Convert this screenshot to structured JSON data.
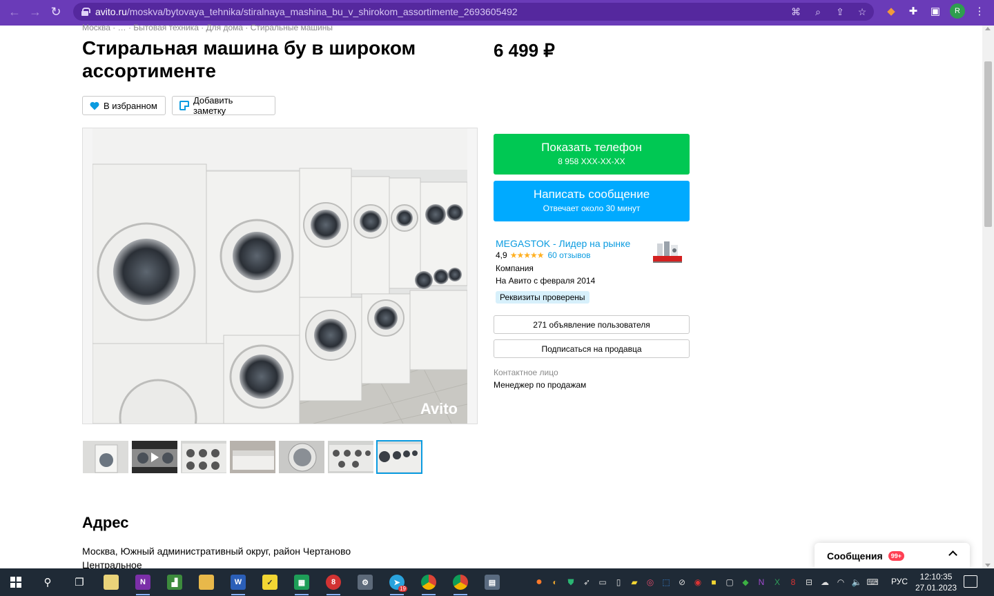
{
  "browser": {
    "url_host": "avito.ru",
    "url_path": "/moskva/bytovaya_tehnika/stiralnaya_mashina_bu_v_shirokom_assortimente_2693605492",
    "profile_initial": "R"
  },
  "listing": {
    "breadcrumbs": "Москва · … · Бытовая техника · Для дома · Стиральные машины",
    "title": "Стиральная машина бу в широком ассортименте",
    "price": "6 499 ₽",
    "favorite_label": "В избранном",
    "note_label": "Добавить заметку",
    "photo_watermark": "Avito",
    "thumbnails": [
      "thumb-1",
      "thumb-2-video",
      "thumb-3",
      "thumb-4",
      "thumb-5",
      "thumb-6",
      "thumb-7-active"
    ]
  },
  "contact": {
    "show_phone_label": "Показать телефон",
    "phone_masked": "8 958 XXX-XX-XX",
    "write_message_label": "Написать сообщение",
    "response_time": "Отвечает около 30 минут"
  },
  "seller": {
    "name": "MEGASTOK - Лидер на рынке",
    "rating": "4,9",
    "stars": "★★★★★",
    "reviews": "60 отзывов",
    "type": "Компания",
    "since": "На Авито с февраля 2014",
    "verified": "Реквизиты проверены",
    "listings_button": "271 объявление пользователя",
    "subscribe_button": "Подписаться на продавца",
    "contact_person_label": "Контактное лицо",
    "contact_person_value": "Менеджер по продажам"
  },
  "address": {
    "title": "Адрес",
    "line1": "Москва, Южный административный округ, район Чертаново",
    "line2": "Центральное"
  },
  "messages_widget": {
    "label": "Сообщения",
    "badge": "99+"
  },
  "taskbar": {
    "language": "РУС",
    "time": "12:10:35",
    "date": "27.01.2023",
    "telegram_badge": "19"
  },
  "colors": {
    "chrome": "#6a3bb8",
    "phone_button": "#00c853",
    "message_button": "#00aaff",
    "link": "#0a9be0",
    "star": "#ffb021",
    "verified_bg": "#d7f0fb",
    "taskbar": "#1f2a36"
  }
}
